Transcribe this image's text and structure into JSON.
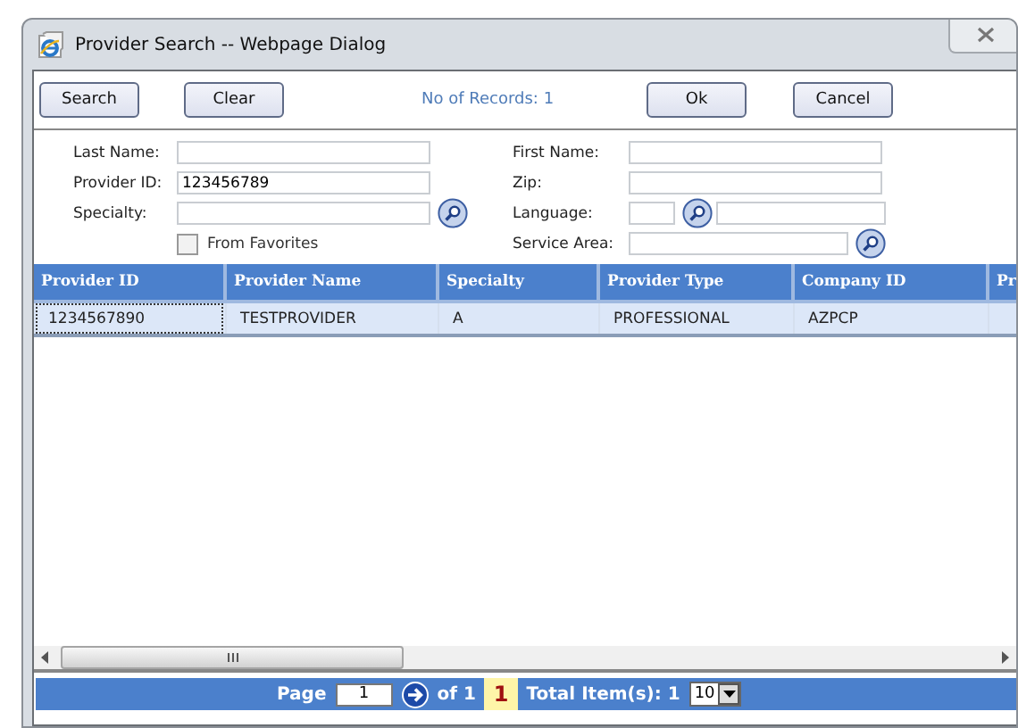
{
  "window": {
    "title": "Provider Search -- Webpage Dialog"
  },
  "toolbar": {
    "buttons_left": [
      "Search",
      "Clear"
    ],
    "record_count": "No of Records: 1",
    "buttons_right": [
      "Ok",
      "Cancel"
    ]
  },
  "form": {
    "left": [
      {
        "kind": "text",
        "label": "Last Name:"
      },
      {
        "kind": "text",
        "label": "Provider ID:",
        "value": "123456789"
      },
      {
        "kind": "lookup",
        "label": "Specialty:"
      },
      {
        "kind": "checkbox",
        "label": "From Favorites",
        "checked": false
      }
    ],
    "right": [
      {
        "kind": "text",
        "label": "First Name:"
      },
      {
        "kind": "text",
        "label": "Zip:"
      },
      {
        "kind": "split-lookup",
        "label": "Language:"
      },
      {
        "kind": "lookup",
        "label": "Service Area:"
      }
    ]
  },
  "table": {
    "columns": [
      "Provider ID",
      "Provider Name",
      "Specialty",
      "Provider Type",
      "Company ID",
      "Pr"
    ],
    "rows": [
      {
        "selected": true,
        "cells": [
          "1234567890",
          "TESTPROVIDER",
          "A",
          "PROFESSIONAL",
          "AZPCP",
          ""
        ]
      }
    ]
  },
  "pager": {
    "page_label": "Page",
    "page_value": "1",
    "of_label": "of 1",
    "current_page": "1",
    "total": "Total Item(s): 1",
    "page_size": "10"
  }
}
